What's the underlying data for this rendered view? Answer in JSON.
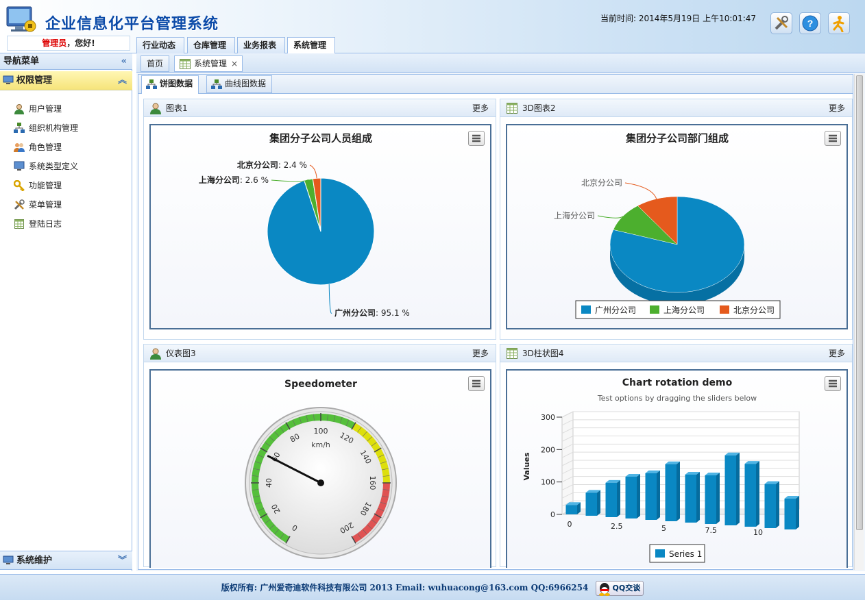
{
  "header": {
    "title": "企业信息化平台管理系统",
    "greeting_role": "管理员",
    "greeting_suffix": "，您好!",
    "time_text": "当前时间: 2014年5月19日 上午10:01:47",
    "icons": [
      "tools-icon",
      "help-icon",
      "logout-icon"
    ],
    "tabs": [
      "行业动态",
      "仓库管理",
      "业务报表",
      "系统管理"
    ]
  },
  "sidebar": {
    "title": "导航菜单",
    "section_active": "权限管理",
    "items": [
      {
        "label": "用户管理",
        "icon": "user-icon"
      },
      {
        "label": "组织机构管理",
        "icon": "org-icon"
      },
      {
        "label": "角色管理",
        "icon": "role-icon"
      },
      {
        "label": "系统类型定义",
        "icon": "monitor-icon"
      },
      {
        "label": "功能管理",
        "icon": "key-icon"
      },
      {
        "label": "菜单管理",
        "icon": "tools-icon"
      },
      {
        "label": "登陆日志",
        "icon": "log-icon"
      }
    ],
    "section_collapsed": "系统维护"
  },
  "main": {
    "page_tabs": [
      "首页",
      "系统管理"
    ],
    "close_glyph": "×",
    "sub_tabs": [
      "饼图数据",
      "曲线图数据"
    ],
    "more_label": "更多",
    "panels": [
      {
        "title": "图表1",
        "icon": "user-icon"
      },
      {
        "title": "3D图表2",
        "icon": "table-icon"
      },
      {
        "title": "仪表图3",
        "icon": "user-icon"
      },
      {
        "title": "3D柱状图4",
        "icon": "table-icon"
      }
    ]
  },
  "colors": {
    "blue": "#0a88c3",
    "green": "#4caf2e",
    "orange": "#e55a1d"
  },
  "chart_data": [
    {
      "type": "pie",
      "title": "集团分子公司人员组成",
      "slices": [
        {
          "name": "广州分公司",
          "value": 95.1,
          "label": "广州分公司",
          "pct": ": 95.1 %"
        },
        {
          "name": "上海分公司",
          "value": 2.6,
          "label": "上海分公司",
          "pct": ": 2.6 %"
        },
        {
          "name": "北京分公司",
          "value": 2.4,
          "label": "北京分公司",
          "pct": ": 2.4 %"
        }
      ]
    },
    {
      "type": "pie",
      "title": "集团分子公司部门组成",
      "style": "3d",
      "slices": [
        {
          "name": "广州分公司",
          "value": 80
        },
        {
          "name": "上海分公司",
          "value": 10
        },
        {
          "name": "北京分公司",
          "value": 10
        }
      ],
      "legend": [
        "广州分公司",
        "上海分公司",
        "北京分公司"
      ]
    },
    {
      "type": "gauge",
      "title": "Speedometer",
      "unit": "km/h",
      "min": 0,
      "max": 200,
      "value": 58,
      "ticks": [
        "0",
        "20",
        "40",
        "60",
        "80",
        "100",
        "120",
        "140",
        "160",
        "180",
        "200"
      ],
      "bands": [
        {
          "from": 0,
          "to": 120,
          "color": "#55bf3b"
        },
        {
          "from": 120,
          "to": 160,
          "color": "#dddf0d"
        },
        {
          "from": 160,
          "to": 200,
          "color": "#df5353"
        }
      ]
    },
    {
      "type": "bar",
      "style": "3d",
      "title": "Chart rotation demo",
      "subtitle": "Test options by dragging the sliders below",
      "ylabel": "Values",
      "ylim": [
        0,
        300
      ],
      "yticks": [
        "0",
        "100",
        "200",
        "300"
      ],
      "xticks": [
        "0",
        "2.5",
        "5",
        "7.5",
        "10"
      ],
      "series": [
        {
          "name": "Series 1",
          "values": [
            29,
            71,
            106,
            129,
            144,
            176,
            148,
            150,
            216,
            194,
            136,
            95
          ]
        }
      ]
    }
  ],
  "footer": {
    "text": "版权所有: 广州爱奇迪软件科技有限公司 2013 Email: wuhuacong@163.com QQ:6966254",
    "qq_button": "QQ交谈"
  }
}
